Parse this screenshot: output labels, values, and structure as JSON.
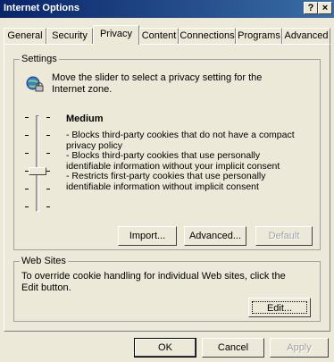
{
  "window": {
    "title": "Internet Options",
    "help_button": "?",
    "close_button": "×"
  },
  "tabs": [
    {
      "label": "General"
    },
    {
      "label": "Security"
    },
    {
      "label": "Privacy"
    },
    {
      "label": "Content"
    },
    {
      "label": "Connections"
    },
    {
      "label": "Programs"
    },
    {
      "label": "Advanced"
    }
  ],
  "active_tab": "Privacy",
  "settings": {
    "group_label": "Settings",
    "intro": "Move the slider to select a privacy setting for the Internet zone.",
    "slider_level": "Medium",
    "slider_position": "3 of 6",
    "level_lines": [
      "- Blocks third-party cookies that do not have a compact privacy policy",
      "- Blocks third-party cookies that use personally identifiable information without your implicit consent",
      "- Restricts first-party cookies that use personally identifiable information without implicit consent"
    ],
    "import_button": "Import...",
    "advanced_button": "Advanced...",
    "default_button": "Default"
  },
  "websites": {
    "group_label": "Web Sites",
    "text": "To override cookie handling for individual Web sites, click the Edit button.",
    "edit_button": "Edit..."
  },
  "footer": {
    "ok": "OK",
    "cancel": "Cancel",
    "apply": "Apply"
  }
}
